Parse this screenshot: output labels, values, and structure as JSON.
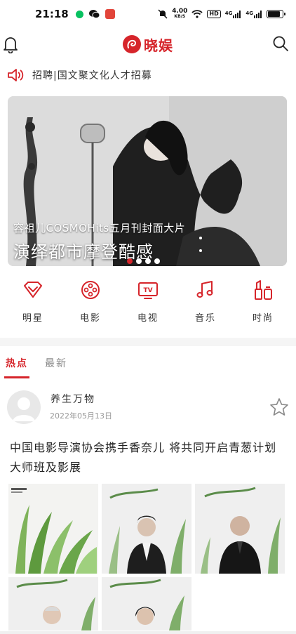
{
  "status_bar": {
    "time": "21:18",
    "net_speed_value": "4.00",
    "net_speed_unit": "KB/S",
    "hd": "HD",
    "net1": "4G",
    "net2": "4G",
    "battery_level": 0.85
  },
  "header": {
    "logo_text": "晓娱"
  },
  "announcement": {
    "text": "招聘|国文聚文化人才招募"
  },
  "banner": {
    "subtitle": "容祖儿COSMOHits五月刊封面大片",
    "title": "演绎都市摩登酷感",
    "slide_count": 4,
    "active_slide": 0
  },
  "categories": [
    {
      "label": "明星",
      "icon": "diamond-icon"
    },
    {
      "label": "电影",
      "icon": "film-reel-icon"
    },
    {
      "label": "电视",
      "icon": "tv-icon"
    },
    {
      "label": "音乐",
      "icon": "music-note-icon"
    },
    {
      "label": "时尚",
      "icon": "lipstick-icon"
    }
  ],
  "tabs": [
    {
      "label": "热点",
      "active": true
    },
    {
      "label": "最新",
      "active": false
    }
  ],
  "post": {
    "author": "养生万物",
    "date": "2022年05月13日",
    "title": "中国电影导演协会携手香奈儿 将共同开启青葱计划大师班及影展",
    "image_count": 5
  },
  "colors": {
    "brand_red": "#d6252b",
    "muted_text": "#999999"
  }
}
